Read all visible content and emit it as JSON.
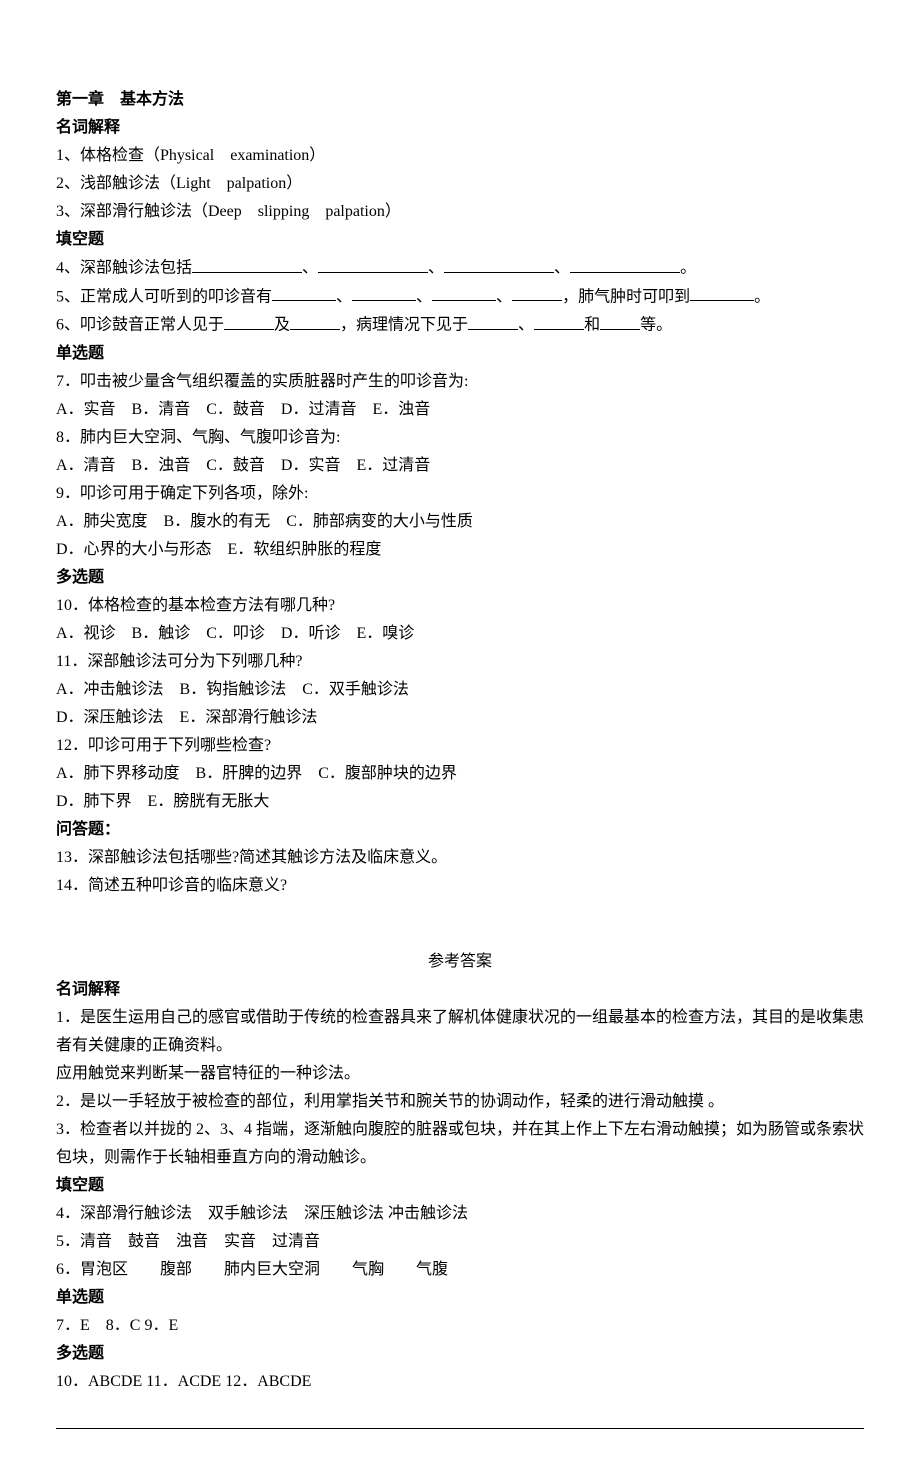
{
  "chapter_title": "第一章　基本方法",
  "section_terms_heading": "名词解释",
  "terms": {
    "t1": "1、体格检查（Physical　examination）",
    "t2": "2、浅部触诊法（Light　palpation）",
    "t3": "3、深部滑行触诊法（Deep　slipping　palpation）"
  },
  "section_fill_heading": "填空题",
  "fill_4_prefix": "4、深部触诊法包括",
  "fill_4_sep": "、",
  "fill_4_end": "。",
  "fill_5_prefix": "5、正常成人可听到的叩诊音有",
  "fill_5_sep": "、",
  "fill_5_mid": "，肺气肿时可叩到",
  "fill_5_end": "。",
  "fill_6_prefix": "6、叩诊鼓音正常人见于",
  "fill_6_and": "及",
  "fill_6_mid": "，病理情况下见于",
  "fill_6_sep1": "、",
  "fill_6_sep2": "和",
  "fill_6_end": "等。",
  "section_single_heading": "单选题",
  "single": {
    "q7": "7．叩击被少量含气组织覆盖的实质脏器时产生的叩诊音为:",
    "q7_opts": "A．实音　B．清音　C．鼓音　D．过清音　E．浊音",
    "q8": "8．肺内巨大空洞、气胸、气腹叩诊音为:",
    "q8_opts": "A．清音　B．浊音　C．鼓音　D．实音　E．过清音",
    "q9": "9．叩诊可用于确定下列各项，除外:",
    "q9_opts1": "A．肺尖宽度　B．腹水的有无　C．肺部病变的大小与性质",
    "q9_opts2": "D．心界的大小与形态　E．软组织肿胀的程度"
  },
  "section_multi_heading": "多选题",
  "multi": {
    "q10": "10．体格检查的基本检查方法有哪几种?",
    "q10_opts": "A．视诊　B．触诊　C．叩诊　D．听诊　E．嗅诊",
    "q11": "11．深部触诊法可分为下列哪几种?",
    "q11_opts1": "A．冲击触诊法　B．钩指触诊法　C．双手触诊法",
    "q11_opts2": "D．深压触诊法　E．深部滑行触诊法",
    "q12": "12．叩诊可用于下列哪些检查?",
    "q12_opts1": "A．肺下界移动度　B．肝脾的边界　C．腹部肿块的边界",
    "q12_opts2": "D．肺下界　E．膀胱有无胀大"
  },
  "section_qa_heading": "问答题：",
  "qa": {
    "q13": "13．深部触诊法包括哪些?简述其触诊方法及临床意义。",
    "q14": "14．简述五种叩诊音的临床意义?"
  },
  "answers_title": "参考答案",
  "ans_terms_heading": "名词解释",
  "ans_terms": {
    "a1_l1": "1．是医生运用自己的感官或借助于传统的检查器具来了解机体健康状况的一组最基本的检查方法，其目的是收集患者有关健康的正确资料。",
    "a1_l2": "应用触觉来判断某一器官特征的一种诊法。",
    "a2": "2．是以一手轻放于被检查的部位，利用掌指关节和腕关节的协调动作，轻柔的进行滑动触摸 。",
    "a3": "3．检查者以并拢的 2、3、4 指端，逐渐触向腹腔的脏器或包块，并在其上作上下左右滑动触摸；如为肠管或条索状包块，则需作于长轴相垂直方向的滑动触诊。"
  },
  "ans_fill_heading": "填空题",
  "ans_fill": {
    "a4": "4．深部滑行触诊法　双手触诊法　深压触诊法 冲击触诊法",
    "a5": "5．清音　鼓音　浊音　实音　过清音",
    "a6": "6．胃泡区　　腹部　　肺内巨大空洞　　气胸　　气腹"
  },
  "ans_single_heading": "单选题",
  "ans_single": "7．E　8．C 9．E",
  "ans_multi_heading": "多选题",
  "ans_multi": "10．ABCDE 11．ACDE 12．ABCDE"
}
